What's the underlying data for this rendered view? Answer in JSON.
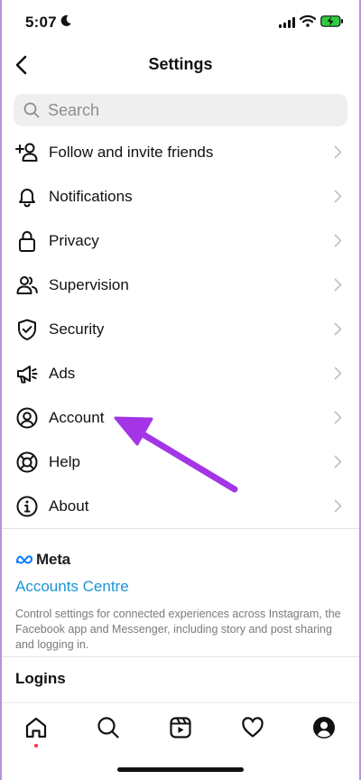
{
  "status_bar": {
    "time": "5:07",
    "icons": [
      "moon-icon",
      "signal-icon",
      "wifi-icon",
      "battery-charging-icon"
    ]
  },
  "header": {
    "title": "Settings",
    "back_icon": "chevron-left-icon"
  },
  "search": {
    "placeholder": "Search",
    "icon": "search-icon"
  },
  "menu": {
    "items": [
      {
        "label": "Follow and invite friends",
        "icon": "add-person-icon"
      },
      {
        "label": "Notifications",
        "icon": "bell-icon"
      },
      {
        "label": "Privacy",
        "icon": "lock-icon"
      },
      {
        "label": "Supervision",
        "icon": "people-icon"
      },
      {
        "label": "Security",
        "icon": "shield-check-icon"
      },
      {
        "label": "Ads",
        "icon": "megaphone-icon"
      },
      {
        "label": "Account",
        "icon": "person-circle-icon"
      },
      {
        "label": "Help",
        "icon": "lifebuoy-icon"
      },
      {
        "label": "About",
        "icon": "info-icon"
      }
    ]
  },
  "meta": {
    "logo_text": "Meta",
    "accounts_centre": "Accounts Centre",
    "description": "Control settings for connected experiences across Instagram, the Facebook app and Messenger, including story and post sharing and logging in."
  },
  "logins": {
    "title": "Logins"
  },
  "tab_bar": {
    "tabs": [
      "home-icon",
      "search-icon",
      "reels-icon",
      "heart-icon",
      "profile-icon"
    ]
  },
  "colors": {
    "accent_link": "#1b95d4",
    "annotation_arrow": "#a335e6",
    "notification_dot": "#ff3040"
  }
}
